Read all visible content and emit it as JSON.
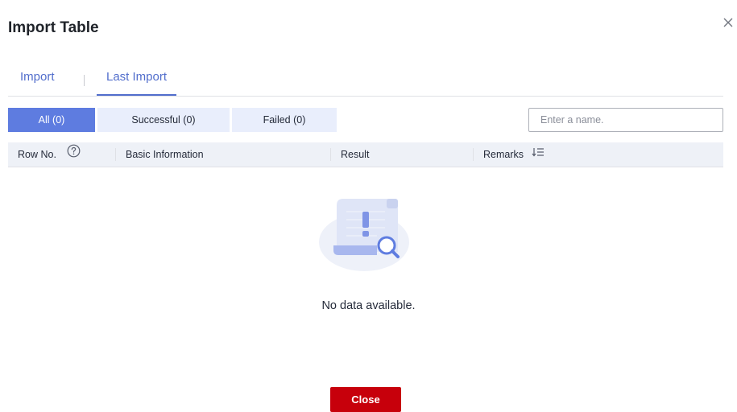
{
  "dialog": {
    "title": "Import Table",
    "close_icon": "close-icon"
  },
  "tabs": [
    {
      "label": "Import",
      "active": false
    },
    {
      "label": "Last Import",
      "active": true
    }
  ],
  "filters": [
    {
      "label": "All (0)",
      "active": true
    },
    {
      "label": "Successful (0)",
      "active": false
    },
    {
      "label": "Failed (0)",
      "active": false
    }
  ],
  "search": {
    "placeholder": "Enter a name.",
    "value": ""
  },
  "table": {
    "columns": [
      "Row No.",
      "Basic Information",
      "Result",
      "Remarks"
    ],
    "row_no_icon": "help-circle-icon",
    "remarks_icon": "sort-icon",
    "rows": []
  },
  "empty": {
    "icon": "no-data-illustration",
    "text": "No data available."
  },
  "footer": {
    "close_label": "Close"
  },
  "colors": {
    "accent": "#5e7ce0",
    "tab_active": "#526ecc",
    "danger": "#c7000b",
    "header_bg": "#eef1f7"
  }
}
